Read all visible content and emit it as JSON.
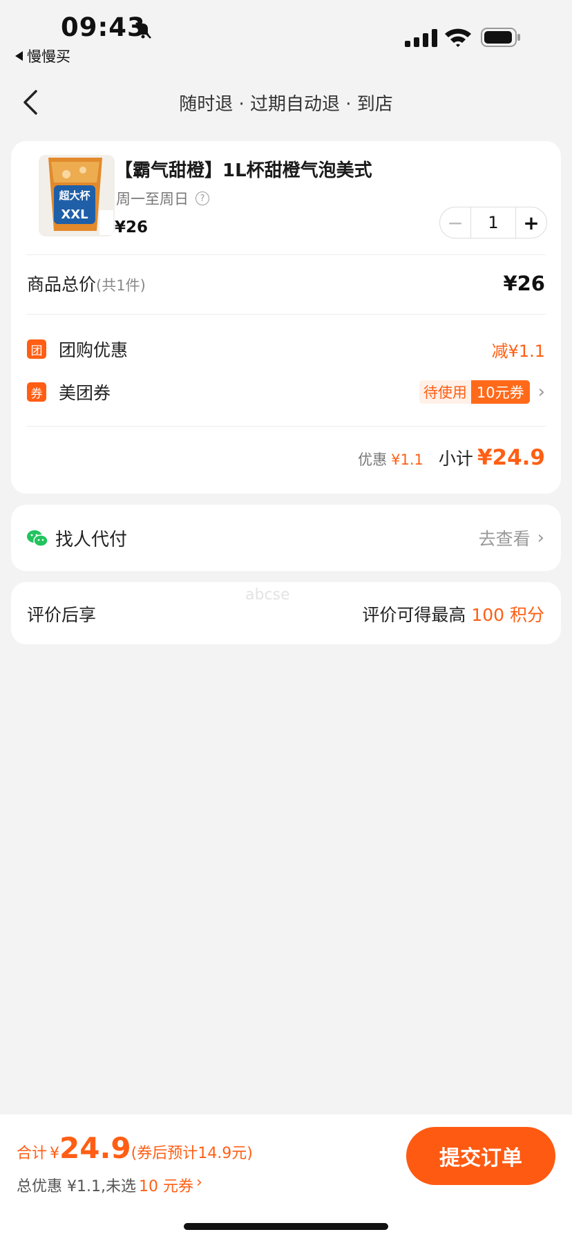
{
  "status": {
    "time": "09:43",
    "back_app": "慢慢买"
  },
  "nav": {
    "title": "随时退 · 过期自动退 · 到店"
  },
  "product": {
    "name": "【霸气甜橙】1L杯甜橙气泡美式",
    "availability": "周一至周日",
    "help_icon": "?",
    "price": "¥26",
    "quantity": "1",
    "image_text": [
      "超大杯",
      "XXL"
    ]
  },
  "totals": {
    "label": "商品总价",
    "count": "(共1件)",
    "amount": "¥26"
  },
  "discounts": [
    {
      "icon": "团",
      "label": "团购优惠",
      "value": "减¥1.1"
    },
    {
      "icon": "券",
      "label": "美团券",
      "status": "待使用",
      "coupon": "10元券"
    }
  ],
  "subtotal": {
    "discount_label": "优惠",
    "discount_value": "¥1.1",
    "label": "小计",
    "value": "¥24.9"
  },
  "pay_for_me": {
    "label": "找人代付",
    "action": "去查看"
  },
  "review": {
    "label": "评价后享",
    "text": "评价可得最高",
    "points": "100 积分"
  },
  "watermark": "abcse",
  "bottom": {
    "total_label": "合计",
    "currency": "¥",
    "total_amount": "24.9",
    "note": "(券后预计14.9元)",
    "discount_text": "总优惠 ¥1.1,未选",
    "coupon_hint": "10 元券",
    "submit": "提交订单"
  },
  "colors": {
    "accent": "#ff5e14",
    "background": "#f3f3f3",
    "wechat": "#22c35e"
  }
}
